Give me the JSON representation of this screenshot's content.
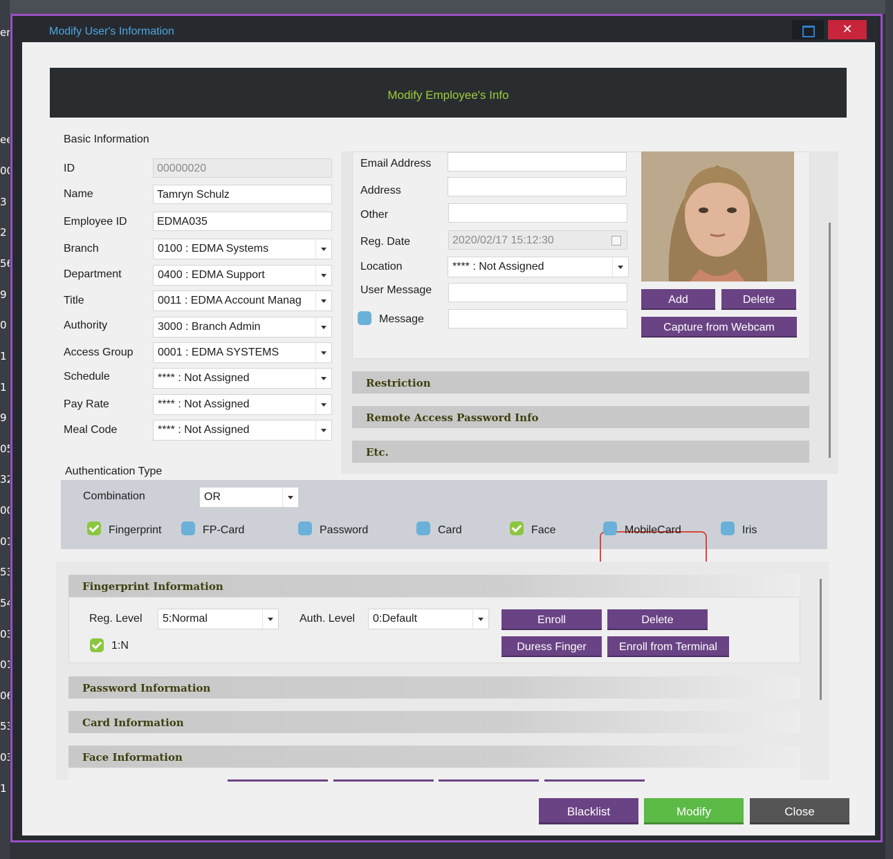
{
  "window": {
    "title": "Modify User's Information",
    "close_symbol": "✕"
  },
  "banner": {
    "title": "Modify Employee's Info"
  },
  "background_rows": [
    "er",
    "ee",
    "00",
    "3",
    "2",
    "56",
    "9",
    "0",
    "1",
    "1",
    "9",
    "05",
    "32",
    "00",
    "01",
    "53",
    "54",
    "03",
    "01",
    "06",
    "53",
    "03",
    "1"
  ],
  "basic": {
    "section_label": "Basic Information",
    "id": {
      "label": "ID",
      "value": "00000020"
    },
    "name": {
      "label": "Name",
      "value": "Tamryn Schulz"
    },
    "employee_id": {
      "label": "Employee ID",
      "value": "EDMA035"
    },
    "branch": {
      "label": "Branch",
      "value": "0100 : EDMA Systems"
    },
    "department": {
      "label": "Department",
      "value": "0400 : EDMA Support"
    },
    "title": {
      "label": "Title",
      "value": "0011 : EDMA Account Manag"
    },
    "authority": {
      "label": "Authority",
      "value": "3000 : Branch Admin"
    },
    "access_group": {
      "label": "Access Group",
      "value": "0001 : EDMA SYSTEMS"
    },
    "schedule": {
      "label": "Schedule",
      "value": "**** : Not Assigned"
    },
    "pay_rate": {
      "label": "Pay Rate",
      "value": "**** : Not Assigned"
    },
    "meal_code": {
      "label": "Meal Code",
      "value": "**** : Not Assigned"
    }
  },
  "contact": {
    "email": {
      "label": "Email Address",
      "value": ""
    },
    "address": {
      "label": "Address",
      "value": ""
    },
    "other": {
      "label": "Other",
      "value": ""
    },
    "reg_date": {
      "label": "Reg. Date",
      "value": "2020/02/17 15:12:30"
    },
    "location": {
      "label": "Location",
      "value": "**** : Not Assigned"
    },
    "user_message": {
      "label": "User Message",
      "value": ""
    },
    "message": {
      "label": "Message",
      "value": "",
      "checked": false
    }
  },
  "photo": {
    "add_label": "Add",
    "delete_label": "Delete",
    "webcam_label": "Capture from Webcam"
  },
  "collapsible_sections": {
    "restriction": "Restriction",
    "remote_access": "Remote Access Password Info",
    "etc": "Etc."
  },
  "auth": {
    "section_label": "Authentication Type",
    "combination_label": "Combination",
    "combination_value": "OR",
    "types": [
      {
        "label": "Fingerprint",
        "checked": true
      },
      {
        "label": "FP-Card",
        "checked": false
      },
      {
        "label": "Password",
        "checked": false
      },
      {
        "label": "Card",
        "checked": false
      },
      {
        "label": "Face",
        "checked": true
      },
      {
        "label": "MobileCard",
        "checked": false
      },
      {
        "label": "Iris",
        "checked": false
      }
    ]
  },
  "fingerprint": {
    "header": "Fingerprint Information",
    "reg_level_label": "Reg. Level",
    "reg_level_value": "5:Normal",
    "auth_level_label": "Auth. Level",
    "auth_level_value": "0:Default",
    "one_to_n_label": "1:N",
    "one_to_n_checked": true,
    "enroll_label": "Enroll",
    "delete_label": "Delete",
    "duress_label": "Duress Finger",
    "enroll_terminal_label": "Enroll from Terminal"
  },
  "other_sections": {
    "password": "Password Information",
    "card": "Card Information",
    "face": "Face Information"
  },
  "footer": {
    "blacklist_label": "Blacklist",
    "modify_label": "Modify",
    "close_label": "Close"
  },
  "colors": {
    "window_border": "#9b4fc7",
    "title_text": "#4fa6e0",
    "banner_text": "#9ccd3a",
    "purple_button": "#6a4384",
    "modify_button": "#5cba47",
    "close_button": "#555555",
    "check_on": "#8cc63f",
    "check_off": "#6ab0d8",
    "highlight": "#d9463a"
  }
}
